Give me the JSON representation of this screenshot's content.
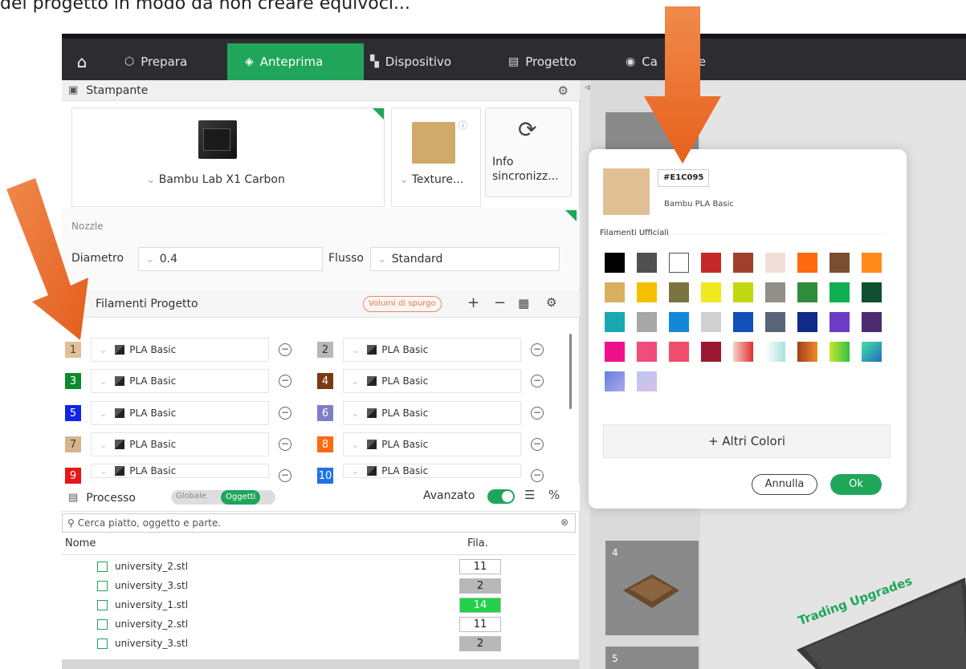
{
  "caption": "del progetto in modo da non creare equivoci...",
  "nav": {
    "items": [
      {
        "label": "Prepara",
        "icon": "cube-icon"
      },
      {
        "label": "Anteprima",
        "icon": "layers-icon"
      },
      {
        "label": "Dispositivo",
        "icon": "device-icon"
      },
      {
        "label": "Progetto",
        "icon": "document-icon"
      },
      {
        "label": "Ca",
        "icon": "target-icon"
      },
      {
        "label": "ione",
        "icon": ""
      }
    ]
  },
  "printer": {
    "section_title": "Stampante",
    "model": "Bambu Lab X1 Carbon",
    "plate": "Texture...",
    "sync_line1": "Info",
    "sync_line2": "sincronizz..."
  },
  "nozzle": {
    "title": "Nozzle",
    "diameter_label": "Diametro",
    "diameter_value": "0.4",
    "flow_label": "Flusso",
    "flow_value": "Standard"
  },
  "filaments": {
    "title": "Filamenti Progetto",
    "purge_label": "Volumi di spurgo",
    "items": [
      {
        "num": "1",
        "name": "PLA Basic",
        "color": "#E1C095",
        "text": "#444444"
      },
      {
        "num": "2",
        "name": "PLA Basic",
        "color": "#B8B8B8",
        "text": "#333333"
      },
      {
        "num": "3",
        "name": "PLA Basic",
        "color": "#0B8A2E",
        "text": "#FFFFFF"
      },
      {
        "num": "4",
        "name": "PLA Basic",
        "color": "#7A3A14",
        "text": "#FFFFFF"
      },
      {
        "num": "5",
        "name": "PLA Basic",
        "color": "#1126E6",
        "text": "#FFFFFF"
      },
      {
        "num": "6",
        "name": "PLA Basic",
        "color": "#7F7FC9",
        "text": "#FFFFFF"
      },
      {
        "num": "7",
        "name": "PLA Basic",
        "color": "#D7B48A",
        "text": "#444444"
      },
      {
        "num": "8",
        "name": "PLA Basic",
        "color": "#FF6A10",
        "text": "#FFFFFF"
      },
      {
        "num": "9",
        "name": "PLA Basic",
        "color": "#E81818",
        "text": "#FFFFFF"
      },
      {
        "num": "10",
        "name": "PLA Basic",
        "color": "#1E74E6",
        "text": "#FFFFFF"
      }
    ]
  },
  "process": {
    "title": "Processo",
    "global_label": "Globale",
    "objects_label": "Oggetti",
    "advanced_label": "Avanzato",
    "search_placeholder": "Cerca piatto, oggetto e parte.",
    "col_name": "Nome",
    "col_fila": "Fila.",
    "rows": [
      {
        "name": "university_2.stl",
        "fila": "11",
        "bg": "#FFFFFF",
        "fg": "#222222"
      },
      {
        "name": "university_3.stl",
        "fila": "2",
        "bg": "#B8B8B8",
        "fg": "#222222"
      },
      {
        "name": "university_1.stl",
        "fila": "14",
        "bg": "#22D14A",
        "fg": "#FFFFFF"
      },
      {
        "name": "university_2.stl",
        "fila": "11",
        "bg": "#FFFFFF",
        "fg": "#222222"
      },
      {
        "name": "university_3.stl",
        "fila": "2",
        "bg": "#B8B8B8",
        "fg": "#222222"
      }
    ]
  },
  "viewport": {
    "thumb_4": "4",
    "thumb_5": "5",
    "bed_text": "Trading Upgrades"
  },
  "popup": {
    "hex": "#E1C095",
    "filament_name": "Bambu PLA Basic",
    "section_label": "Filamenti Ufficiali",
    "more_colors": "+ Altri Colori",
    "cancel": "Annulla",
    "ok": "Ok",
    "colors": [
      "#000000",
      "#505050",
      "#FFFFFF",
      "#C62828",
      "#A0402A",
      "#F2E0D8",
      "#FF6A10",
      "#7A4E30",
      "#FF8A1A",
      "#D9B062",
      "#F5C000",
      "#7C7440",
      "#F2E820",
      "#C2D810",
      "#909088",
      "#2E8C3A",
      "#10B050",
      "#0E5030",
      "#18A8B4",
      "#A8A8A8",
      "#1488D8",
      "#D0D0D0",
      "#1050B8",
      "#5A6478",
      "#102A88",
      "#6C3CC8",
      "#4C2C70",
      "#F0108C",
      "#F04C7C",
      "#F04C6C",
      "#9A1830",
      "grad-red",
      "grad-cyan",
      "grad-orange",
      "grad-green",
      "grad-teal",
      "grad-blue",
      "grad-lilac"
    ],
    "accent": "#1FA65A"
  }
}
